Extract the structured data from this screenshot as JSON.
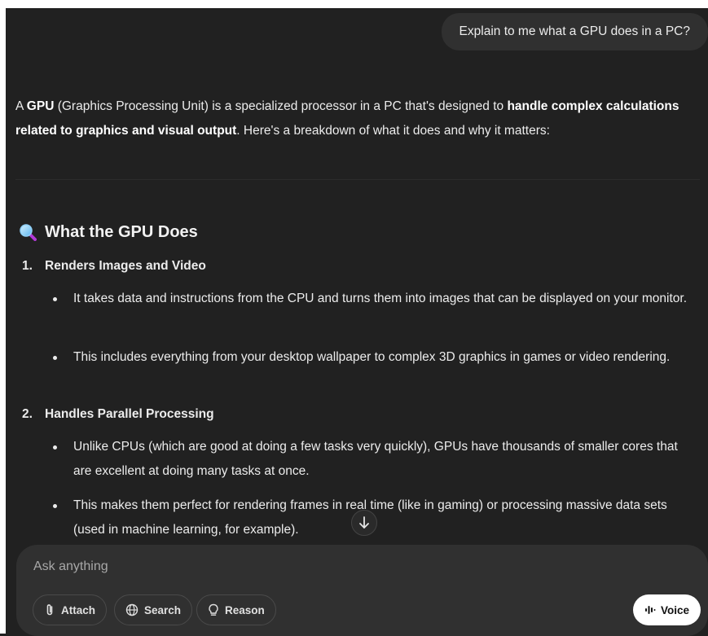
{
  "conversation": {
    "user_message": "Explain to me what a GPU does in a PC?",
    "intro": {
      "p1": "A ",
      "b1": "GPU",
      "p2": " (Graphics Processing Unit) is a specialized processor in a PC that's designed to ",
      "b2": "handle complex calculations related to graphics and visual output",
      "p3": ". Here's a breakdown of what it does and why it matters:"
    },
    "section": {
      "icon": "magnifying-glass-icon",
      "title": "What the GPU Does",
      "items": [
        {
          "number": "1.",
          "title": "Renders Images and Video",
          "bullets": [
            "It takes data and instructions from the CPU and turns them into images that can be displayed on your monitor.",
            "This includes everything from your desktop wallpaper to complex 3D graphics in games or video rendering."
          ]
        },
        {
          "number": "2.",
          "title": "Handles Parallel Processing",
          "bullets": [
            "Unlike CPUs (which are good at doing a few tasks very quickly), GPUs have thousands of smaller cores that are excellent at doing many tasks at once.",
            "This makes them perfect for rendering frames in real time (like in gaming) or processing massive data sets (used in machine learning, for example)."
          ]
        }
      ]
    }
  },
  "composer": {
    "placeholder": "Ask anything",
    "buttons": {
      "attach": "Attach",
      "search": "Search",
      "reason": "Reason",
      "voice": "Voice"
    }
  },
  "colors": {
    "background": "#212121",
    "bubble": "#303030",
    "text": "#ececec"
  }
}
